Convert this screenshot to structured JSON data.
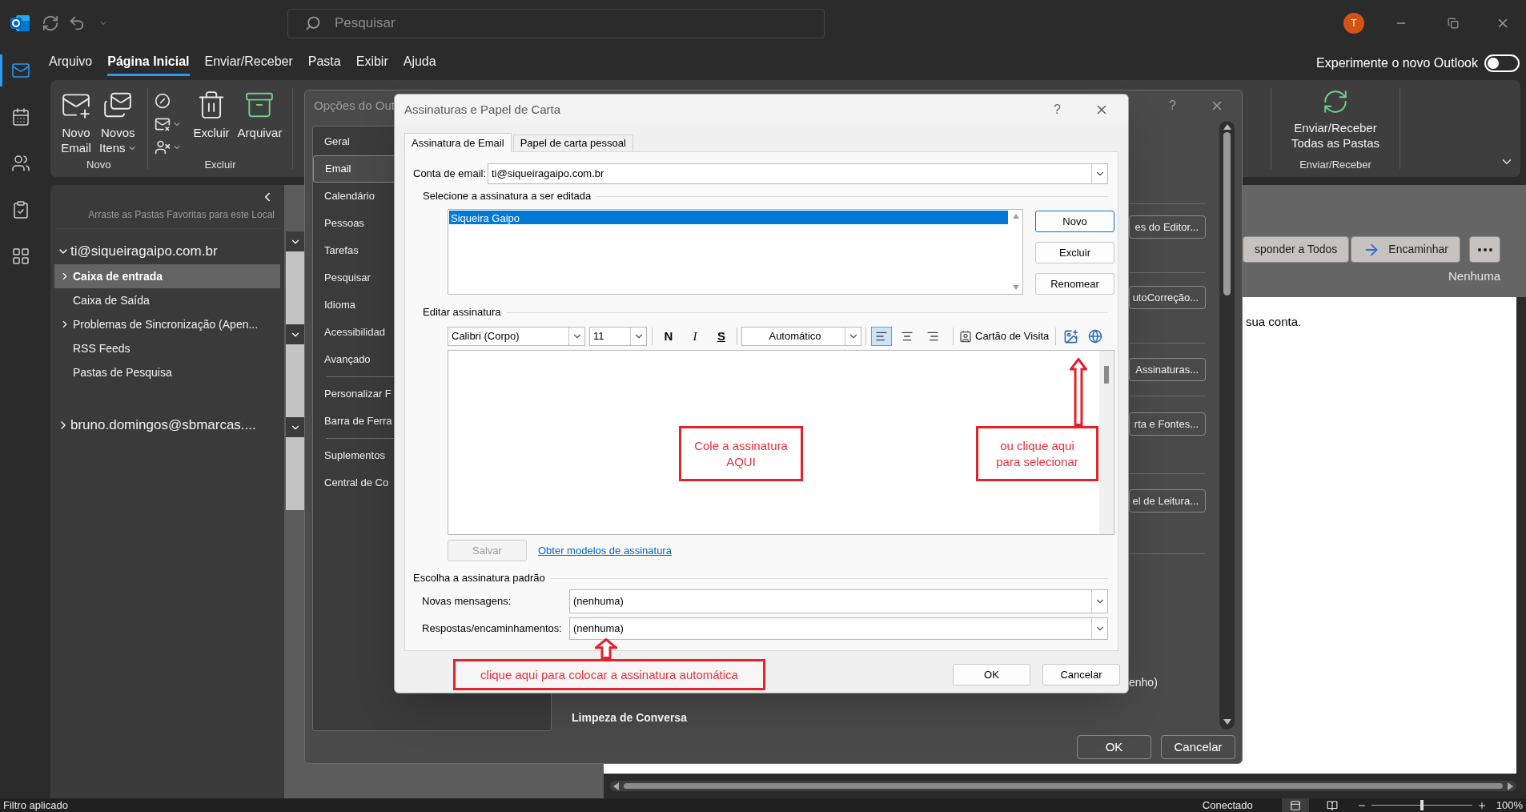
{
  "title_bar": {
    "search": {
      "placeholder": "Pesquisar"
    },
    "avatar": "T"
  },
  "menu": [
    {
      "label": "Arquivo",
      "selected": false
    },
    {
      "label": "Página Inicial",
      "selected": true
    },
    {
      "label": "Enviar/Receber",
      "selected": false
    },
    {
      "label": "Pasta",
      "selected": false
    },
    {
      "label": "Exibir",
      "selected": false
    },
    {
      "label": "Ajuda",
      "selected": false
    }
  ],
  "new_outlook": {
    "label": "Experimente o novo Outlook",
    "on": false
  },
  "rail": [
    {
      "kind": "mail",
      "selected": true
    },
    {
      "kind": "calendar",
      "selected": false
    },
    {
      "kind": "people",
      "selected": false
    },
    {
      "kind": "tasks",
      "selected": false
    },
    {
      "kind": "apps",
      "selected": false
    }
  ],
  "ribbon": {
    "groups": [
      {
        "label": "Novo",
        "items": [
          {
            "kind": "new-email",
            "lines": [
              "Novo",
              "Email"
            ],
            "menu": false
          },
          {
            "kind": "new-items",
            "lines": [
              "Novos",
              "Itens"
            ],
            "menu": true
          }
        ]
      },
      {
        "label": "Excluir",
        "items": [
          {
            "kind": "small-stack",
            "tools": [
              {
                "kind": "ignore",
                "menu": false
              },
              {
                "kind": "cleanup",
                "menu": true
              },
              {
                "kind": "junk",
                "menu": true
              }
            ]
          },
          {
            "kind": "delete",
            "lines": [
              "Excluir"
            ],
            "menu": false
          },
          {
            "kind": "archive",
            "lines": [
              "Arquivar"
            ],
            "menu": false
          }
        ]
      }
    ],
    "send_receive": {
      "label": "Enviar/Receber",
      "lines": [
        "Enviar/Receber",
        "Todas as Pastas"
      ]
    }
  },
  "folder_pane": {
    "hint": "Arraste as Pastas Favoritas para este Local",
    "accounts": [
      {
        "name": "ti@siqueiragaipo.com.br",
        "expanded": true,
        "folders": [
          {
            "name": "Caixa de entrada",
            "selected": true,
            "expandable": true
          },
          {
            "name": "Caixa de Saída",
            "selected": false,
            "expandable": false
          },
          {
            "name": "Problemas de Sincronização (Apen...",
            "selected": false,
            "expandable": true
          },
          {
            "name": "RSS Feeds",
            "selected": false,
            "expandable": false
          },
          {
            "name": "Pastas de Pesquisa",
            "selected": false,
            "expandable": false
          }
        ]
      },
      {
        "name": "bruno.domingos@sbmarcas....",
        "expanded": false
      }
    ]
  },
  "reading_pane": {
    "actions": [
      {
        "kind": "reply-all",
        "label": "sponder a Todos"
      },
      {
        "kind": "forward",
        "label": "Encaminhar"
      },
      {
        "kind": "more"
      }
    ],
    "category": "Nenhuma",
    "body": "sua conta."
  },
  "options_dialog": {
    "title": "Opções do Out",
    "help": "?",
    "nav_groups": [
      {
        "items": [
          {
            "label": "Geral",
            "selected": false
          },
          {
            "label": "Email",
            "selected": true
          },
          {
            "label": "Calendário",
            "selected": false
          },
          {
            "label": "Pessoas",
            "selected": false
          },
          {
            "label": "Tarefas",
            "selected": false
          },
          {
            "label": "Pesquisar",
            "selected": false
          },
          {
            "label": "Idioma",
            "selected": false
          },
          {
            "label": "Acessibilidad",
            "selected": false
          },
          {
            "label": "Avançado",
            "selected": false
          }
        ]
      },
      {
        "items": [
          {
            "label": "Personalizar F",
            "selected": false
          },
          {
            "label": "Barra de Ferra",
            "selected": false
          }
        ]
      },
      {
        "items": [
          {
            "label": "Suplementos",
            "selected": false
          },
          {
            "label": "Central de Co",
            "selected": false
          }
        ]
      }
    ],
    "side_buttons": [
      "es do Editor...",
      "utoCorreção...",
      "Assinaturas...",
      "rta e Fontes...",
      "el de Leitura..."
    ],
    "side_text": "enho)",
    "section_heading": "Limpeza de Conversa",
    "buttons": [
      "OK",
      "Cancelar"
    ]
  },
  "signature_dialog": {
    "title": "Assinaturas e Papel de Carta",
    "help": "?",
    "tabs": [
      {
        "label": "Assinatura de Email",
        "selected": true
      },
      {
        "label": "Papel de carta pessoal",
        "selected": false
      }
    ],
    "account": {
      "label": "Conta de email:",
      "value": "ti@siqueiragaipo.com.br"
    },
    "select_heading": "Selecione a assinatura a ser editada",
    "signatures": [
      {
        "name": "Siqueira Gaipo",
        "selected": true
      }
    ],
    "list_buttons": [
      "Novo",
      "Excluir",
      "Renomear"
    ],
    "edit_heading": "Editar assinatura",
    "toolbar": {
      "font": "Calibri (Corpo)",
      "size": "11",
      "format": [
        {
          "kind": "bold",
          "label": "N"
        },
        {
          "kind": "italic",
          "label": "I"
        },
        {
          "kind": "underline",
          "label": "S"
        }
      ],
      "color_option": "Automático",
      "alignment": [
        {
          "kind": "left",
          "selected": true
        },
        {
          "kind": "center",
          "selected": false
        },
        {
          "kind": "right",
          "selected": false
        }
      ],
      "business_card": "Cartão de Visita"
    },
    "save": {
      "label": "Salvar",
      "disabled": true
    },
    "templates_link": "Obter modelos de assinatura",
    "default_heading": "Escolha a assinatura padrão",
    "defaults": [
      {
        "label": "Novas mensagens:",
        "value": "(nenhuma)"
      },
      {
        "label": "Respostas/encaminhamentos:",
        "value": "(nenhuma)"
      }
    ],
    "buttons": [
      "OK",
      "Cancelar"
    ]
  },
  "annotations": [
    {
      "kind": "paste",
      "lines": [
        "Cole a assinatura",
        "AQUI"
      ]
    },
    {
      "kind": "picture",
      "lines": [
        "ou clique aqui",
        "para selecionar"
      ]
    },
    {
      "kind": "default",
      "lines": [
        "clique aqui para colocar a assinatura automática"
      ]
    }
  ],
  "status_bar": {
    "left": "Filtro aplicado",
    "connection": "Conectado",
    "views": [
      {
        "kind": "normal",
        "selected": true
      },
      {
        "kind": "reading",
        "selected": false
      }
    ],
    "zoom": {
      "level": 0.5,
      "reading": "100%"
    }
  }
}
